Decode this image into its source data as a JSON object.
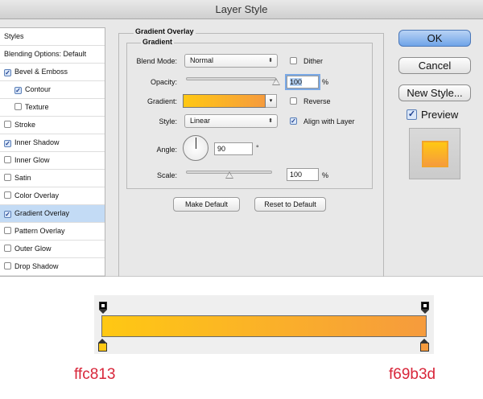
{
  "window": {
    "title": "Layer Style"
  },
  "sidebar": {
    "items": [
      {
        "label": "Styles",
        "checkbox": false,
        "checked": false,
        "indent": false,
        "selected": false
      },
      {
        "label": "Blending Options: Default",
        "checkbox": false,
        "checked": false,
        "indent": false,
        "selected": false
      },
      {
        "label": "Bevel & Emboss",
        "checkbox": true,
        "checked": true,
        "indent": false,
        "selected": false
      },
      {
        "label": "Contour",
        "checkbox": true,
        "checked": true,
        "indent": true,
        "selected": false
      },
      {
        "label": "Texture",
        "checkbox": true,
        "checked": false,
        "indent": true,
        "selected": false
      },
      {
        "label": "Stroke",
        "checkbox": true,
        "checked": false,
        "indent": false,
        "selected": false
      },
      {
        "label": "Inner Shadow",
        "checkbox": true,
        "checked": true,
        "indent": false,
        "selected": false
      },
      {
        "label": "Inner Glow",
        "checkbox": true,
        "checked": false,
        "indent": false,
        "selected": false
      },
      {
        "label": "Satin",
        "checkbox": true,
        "checked": false,
        "indent": false,
        "selected": false
      },
      {
        "label": "Color Overlay",
        "checkbox": true,
        "checked": false,
        "indent": false,
        "selected": false
      },
      {
        "label": "Gradient Overlay",
        "checkbox": true,
        "checked": true,
        "indent": false,
        "selected": true
      },
      {
        "label": "Pattern Overlay",
        "checkbox": true,
        "checked": false,
        "indent": false,
        "selected": false
      },
      {
        "label": "Outer Glow",
        "checkbox": true,
        "checked": false,
        "indent": false,
        "selected": false
      },
      {
        "label": "Drop Shadow",
        "checkbox": true,
        "checked": false,
        "indent": false,
        "selected": false
      }
    ]
  },
  "panel": {
    "title": "Gradient Overlay",
    "group_title": "Gradient",
    "blend_mode": {
      "label": "Blend Mode:",
      "value": "Normal"
    },
    "dither": {
      "label": "Dither",
      "checked": false
    },
    "opacity": {
      "label": "Opacity:",
      "value": "100",
      "unit": "%",
      "level": 1.0
    },
    "gradient": {
      "label": "Gradient:"
    },
    "reverse": {
      "label": "Reverse",
      "checked": false
    },
    "style": {
      "label": "Style:",
      "value": "Linear"
    },
    "align": {
      "label": "Align with Layer",
      "checked": true
    },
    "angle": {
      "label": "Angle:",
      "value": "90",
      "unit": "°"
    },
    "scale": {
      "label": "Scale:",
      "value": "100",
      "unit": "%",
      "level": 0.5
    },
    "make_default": "Make Default",
    "reset_default": "Reset to Default"
  },
  "buttons": {
    "ok": "OK",
    "cancel": "Cancel",
    "new_style": "New Style...",
    "preview": "Preview"
  },
  "gradient_editor": {
    "start_label": "ffc813",
    "end_label": "f69b3d",
    "start_color": "#ffc813",
    "end_color": "#f69b3d"
  },
  "colors": {
    "selection": "#c3dbf5",
    "primary_button": "#6fa4e8",
    "hex_label": "#d8263a",
    "gradient_start": "#ffc813",
    "gradient_end": "#f69b3d"
  }
}
